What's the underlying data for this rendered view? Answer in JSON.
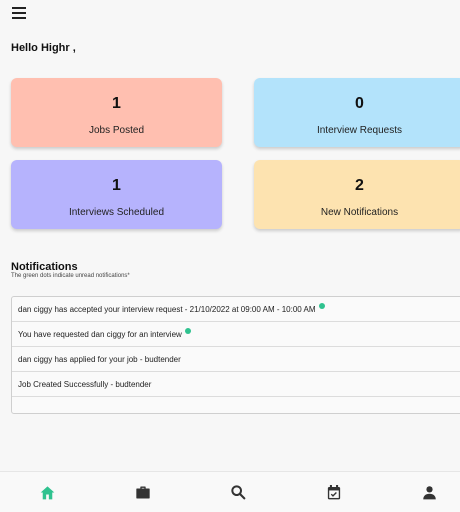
{
  "header": {
    "menu_icon": "hamburger-menu-icon",
    "greeting": "Hello Highr ,"
  },
  "cards": [
    {
      "value": "1",
      "label": "Jobs Posted",
      "color": "#ffbfb0"
    },
    {
      "value": "0",
      "label": "Interview Requests",
      "color": "#b3e3fb"
    },
    {
      "value": "1",
      "label": "Interviews Scheduled",
      "color": "#b6b3fd"
    },
    {
      "value": "2",
      "label": "New Notifications",
      "color": "#fde3b0"
    }
  ],
  "notifications": {
    "title": "Notifications",
    "subtitle": "The green dots indicate unread notifications*",
    "unread_color": "#2fc28f",
    "items": [
      {
        "text": "dan ciggy  has accepted your interview request - 21/10/2022 at 09:00 AM - 10:00 AM",
        "unread": true
      },
      {
        "text": "You have requested dan ciggy  for an interview",
        "unread": true
      },
      {
        "text": "dan ciggy  has applied for your job - budtender",
        "unread": false
      },
      {
        "text": "Job Created Successfully - budtender",
        "unread": false
      }
    ]
  },
  "bottom_nav": {
    "active_color": "#2fc28f",
    "inactive_color": "#333333",
    "items": [
      {
        "icon": "home-icon",
        "active": true
      },
      {
        "icon": "briefcase-icon",
        "active": false
      },
      {
        "icon": "search-icon",
        "active": false
      },
      {
        "icon": "calendar-check-icon",
        "active": false
      },
      {
        "icon": "person-icon",
        "active": false
      }
    ]
  }
}
